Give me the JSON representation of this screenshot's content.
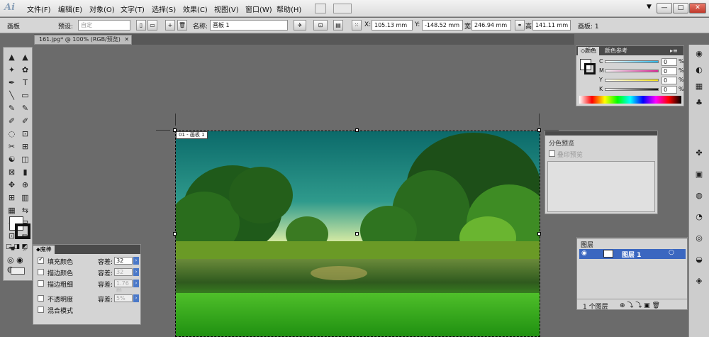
{
  "menubar": {
    "logo": "Ai",
    "items": [
      "文件(F)",
      "编辑(E)",
      "对象(O)",
      "文字(T)",
      "选择(S)",
      "效果(C)",
      "视图(V)",
      "窗口(W)",
      "帮助(H)"
    ],
    "win_min": "—",
    "win_max": "□",
    "win_close": "✕"
  },
  "control": {
    "artboard_label": "画板",
    "preset_label": "预设:",
    "preset_value": "自定",
    "name_label": "名称:",
    "name_value": "画板 1",
    "x_label": "X:",
    "x_value": "105.13 mm",
    "y_label": "Y:",
    "y_value": "-148.52 mm",
    "w_label": "宽",
    "w_value": "246.94 mm",
    "h_label": "高",
    "h_value": "141.11 mm",
    "artboard_count": "画板: 1"
  },
  "document": {
    "tab_title": "161.jpg* @ 100% (RGB/预览)",
    "tab_close": "✕",
    "artboard_label": "01 - 画板 1"
  },
  "tools": {
    "icons": [
      "▲",
      "▲",
      "✦",
      "✿",
      "✒",
      "T",
      "╲",
      "▭",
      "✎",
      "✎",
      "✐",
      "✐",
      "◌",
      "⊡",
      "✂",
      "⊞",
      "☯",
      "◫",
      "⊠",
      "▮",
      "✥",
      "⊕",
      "⊞",
      "▥",
      "▦",
      "⇆",
      "⇢",
      "⊟",
      "⊡",
      "✏",
      "☚",
      "⌕"
    ],
    "mode_icons": [
      "□",
      "◨",
      "◩"
    ]
  },
  "magic_wand": {
    "title": "魔棒",
    "options": [
      {
        "label": "填充颜色",
        "checked": true,
        "tol_label": "容差:",
        "tol_value": "32"
      },
      {
        "label": "描边颜色",
        "checked": false,
        "tol_label": "容差:",
        "tol_value": "32"
      },
      {
        "label": "描边粗细",
        "checked": false,
        "tol_label": "容差:",
        "tol_value": "1.76 m"
      },
      {
        "label": "不透明度",
        "checked": false,
        "tol_label": "容差:",
        "tol_value": "5%"
      },
      {
        "label": "混合模式",
        "checked": false,
        "tol_label": "",
        "tol_value": ""
      }
    ]
  },
  "color_panel": {
    "tab_color": "颜色",
    "tab_guide": "颜色参考",
    "channels": [
      {
        "name": "C",
        "value": "0",
        "pct": "%",
        "gradient": "#2eb8e8"
      },
      {
        "name": "M",
        "value": "0",
        "pct": "%",
        "gradient": "#e0289a"
      },
      {
        "name": "Y",
        "value": "0",
        "pct": "%",
        "gradient": "#f2e01c"
      },
      {
        "name": "K",
        "value": "0",
        "pct": "%",
        "gradient": "#111111"
      }
    ]
  },
  "separations": {
    "title": "分色预览",
    "overprint": "叠印预览"
  },
  "layers": {
    "title": "图层",
    "layer_name": "图层 1",
    "count": "1 个图层"
  },
  "dock": {
    "icons": [
      "◉",
      "◐",
      "▦",
      "♣",
      "✤",
      "▣",
      "◍",
      "◔",
      "◎",
      "◒",
      "◈"
    ]
  }
}
